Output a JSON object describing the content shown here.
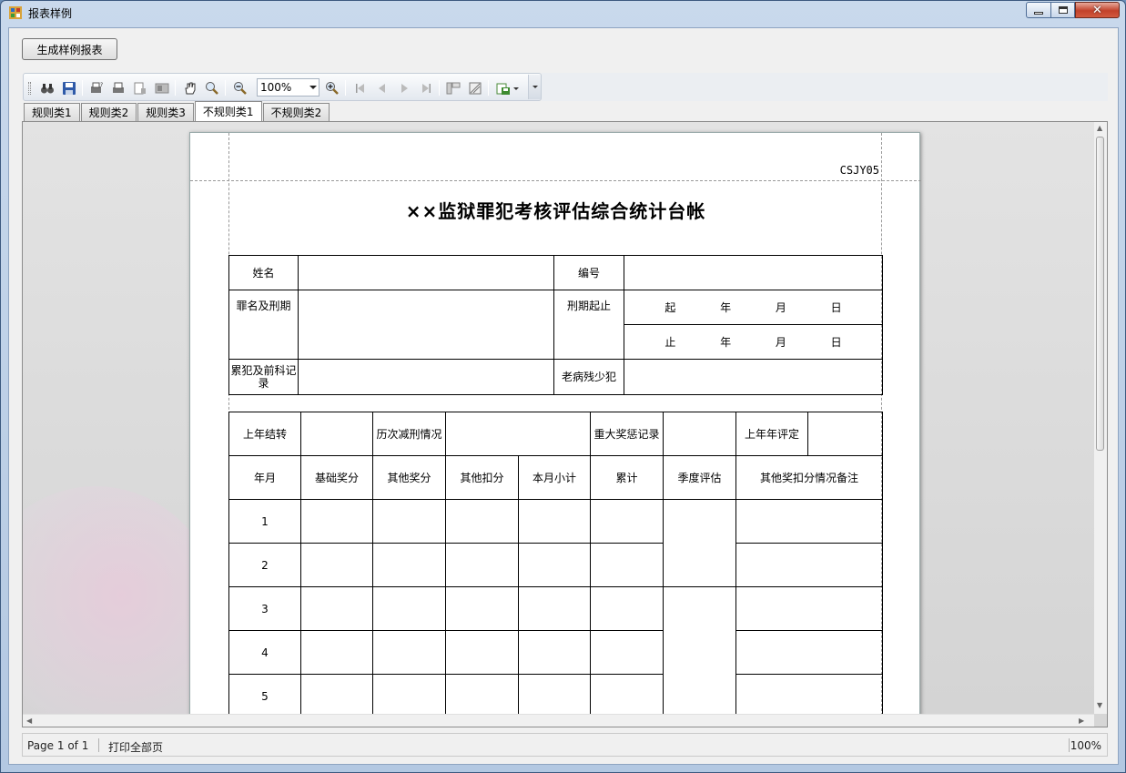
{
  "window": {
    "title": "报表样例"
  },
  "toolbar": {
    "generate_button": "生成样例报表",
    "zoom_value": "100%"
  },
  "tabs": [
    "规则类1",
    "规则类2",
    "规则类3",
    "不规则类1",
    "不规则类2"
  ],
  "active_tab": "不规则类1",
  "report": {
    "code": "CSJY05",
    "title": "××监狱罪犯考核评估综合统计台帐",
    "info": {
      "name_label": "姓名",
      "number_label": "编号",
      "crime_label": "罪名及刑期",
      "term_label": "刑期起止",
      "start": {
        "prefix": "起",
        "year": "年",
        "month": "月",
        "day": "日"
      },
      "end": {
        "prefix": "止",
        "year": "年",
        "month": "月",
        "day": "日"
      },
      "record_label": "累犯及前科记录",
      "special_label": "老病残少犯"
    },
    "summary": {
      "carry_label": "上年结转",
      "reduction_label": "历次减刑情况",
      "award_label": "重大奖惩记录",
      "rating_label": "上年年评定"
    },
    "columns": [
      "年月",
      "基础奖分",
      "其他奖分",
      "其他扣分",
      "本月小计",
      "累计",
      "季度评估",
      "其他奖扣分情况备注"
    ],
    "rows": [
      "1",
      "2",
      "3",
      "4",
      "5"
    ]
  },
  "status": {
    "page": "Page 1 of 1",
    "print_all": "打印全部页",
    "zoom": "100%"
  }
}
